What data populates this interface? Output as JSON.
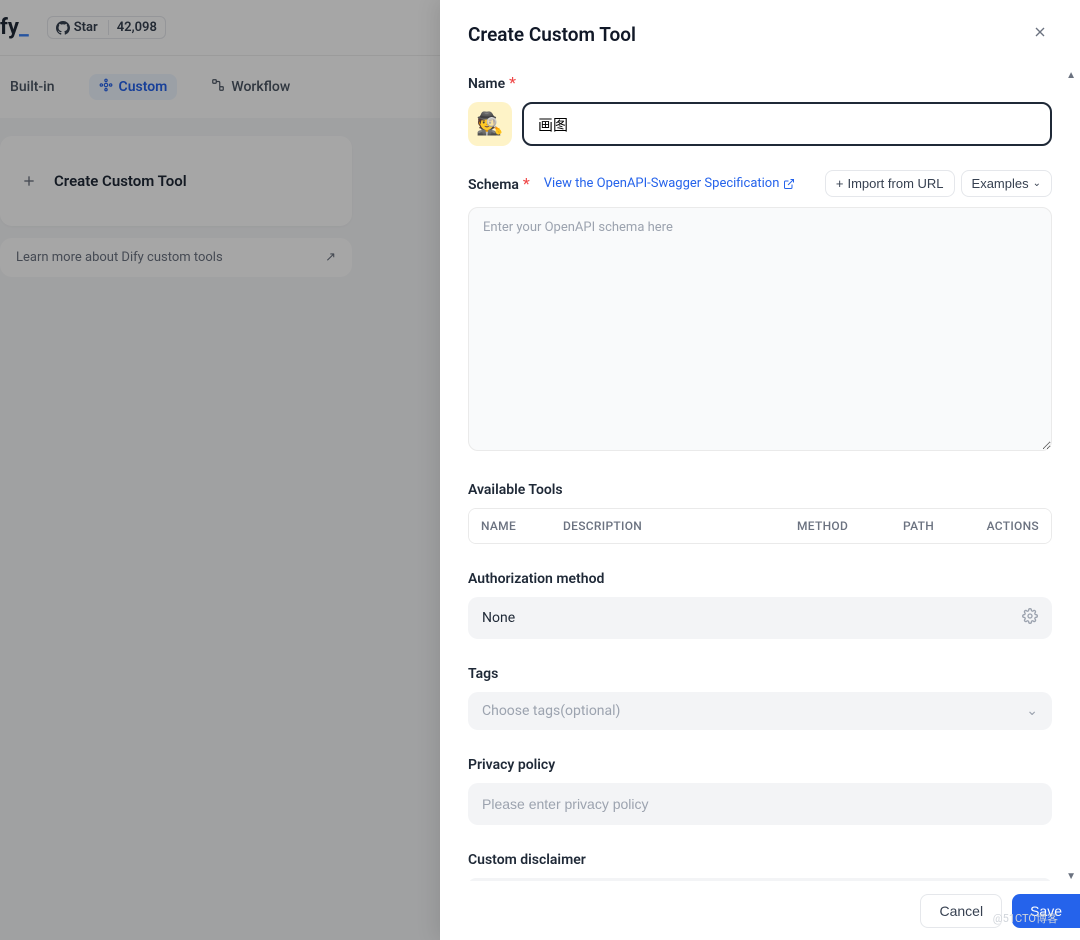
{
  "header": {
    "logo": "fy",
    "logo_suffix": "_",
    "star_label": "Star",
    "star_count": "42,098"
  },
  "tabs": {
    "builtin": "Built-in",
    "custom": "Custom",
    "workflow": "Workflow"
  },
  "card": {
    "create_label": "Create Custom Tool",
    "learn_more": "Learn more about Dify custom tools"
  },
  "modal": {
    "title": "Create Custom Tool",
    "name_label": "Name",
    "name_value": "画图",
    "emoji": "🕵️",
    "schema_label": "Schema",
    "openapi_link": "View the OpenAPI-Swagger Specification",
    "import_url": "Import from URL",
    "examples": "Examples",
    "schema_placeholder": "Enter your OpenAPI schema here",
    "available_tools": "Available Tools",
    "table_headers": {
      "name": "NAME",
      "description": "DESCRIPTION",
      "method": "METHOD",
      "path": "PATH",
      "actions": "ACTIONS"
    },
    "auth_label": "Authorization method",
    "auth_value": "None",
    "tags_label": "Tags",
    "tags_placeholder": "Choose tags(optional)",
    "privacy_label": "Privacy policy",
    "privacy_placeholder": "Please enter privacy policy",
    "disclaimer_label": "Custom disclaimer",
    "cancel": "Cancel",
    "save": "Save"
  },
  "watermark": "@51CTO博客"
}
